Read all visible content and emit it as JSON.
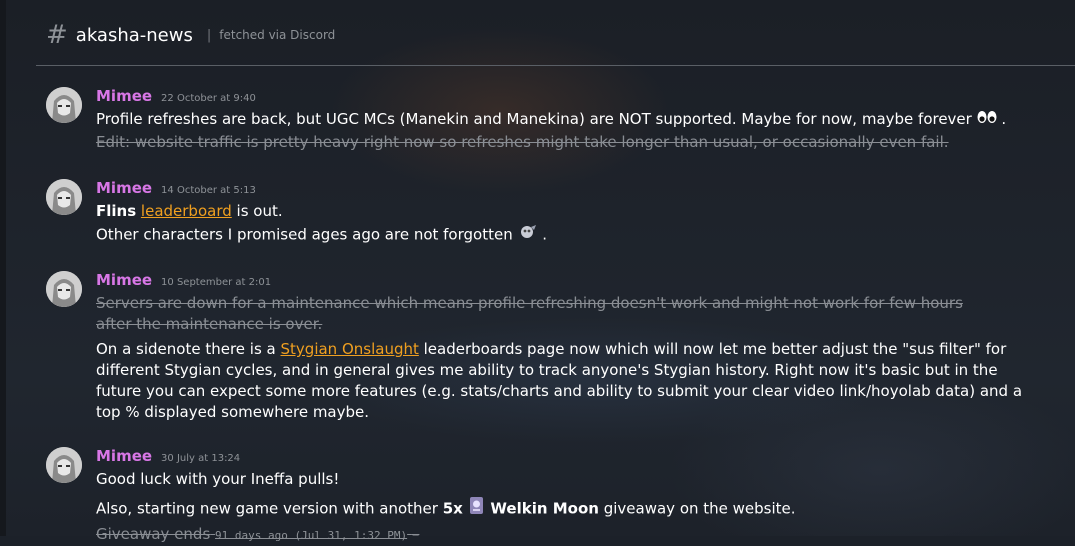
{
  "channel": {
    "name": "akasha-news",
    "separator": "|",
    "source": "fetched via Discord"
  },
  "messages": [
    {
      "author": "Mimee",
      "timestamp": "22 October at 9:40",
      "line1": "Profile refreshes are back, but UGC MCs (Manekin and Manekina) are NOT supported. Maybe for now, maybe forever",
      "line1_end": ".",
      "edit": "Edit: website traffic is pretty heavy right now so refreshes might take longer than usual, or occasionally even fail."
    },
    {
      "author": "Mimee",
      "timestamp": "14 October at 5:13",
      "bold_name": "Flins",
      "link": "leaderboard",
      "after_link": "is out.",
      "line2": "Other characters I promised ages ago are not forgotten",
      "line2_end": "."
    },
    {
      "author": "Mimee",
      "timestamp": "10 September at 2:01",
      "struck": "Servers are down for a maintenance which means profile refreshing doesn't work and might not work for few hours after the maintenance is over.",
      "before_link": "On a sidenote there is a",
      "link": "Stygian Onslaught",
      "after_link": "leaderboards page now which will now let me better adjust the \"sus filter\" for different Stygian cycles, and in general gives me ability to track anyone's Stygian history. Right now it's basic but in the future you can expect some more features (e.g. stats/charts and ability to submit your clear video link/hoyolab data) and a top % displayed somewhere maybe."
    },
    {
      "author": "Mimee",
      "timestamp": "30 July at 13:24",
      "line1": "Good luck with your Ineffa pulls!",
      "line2_start": "Also, starting new game version with another",
      "count": "5x",
      "item": "Welkin Moon",
      "line2_end": "giveaway on the website.",
      "line3_label": "Giveaway ends",
      "line3_code": "91 days ago (Jul 31, 1:32 PM)",
      "line3_end": "–"
    }
  ]
}
